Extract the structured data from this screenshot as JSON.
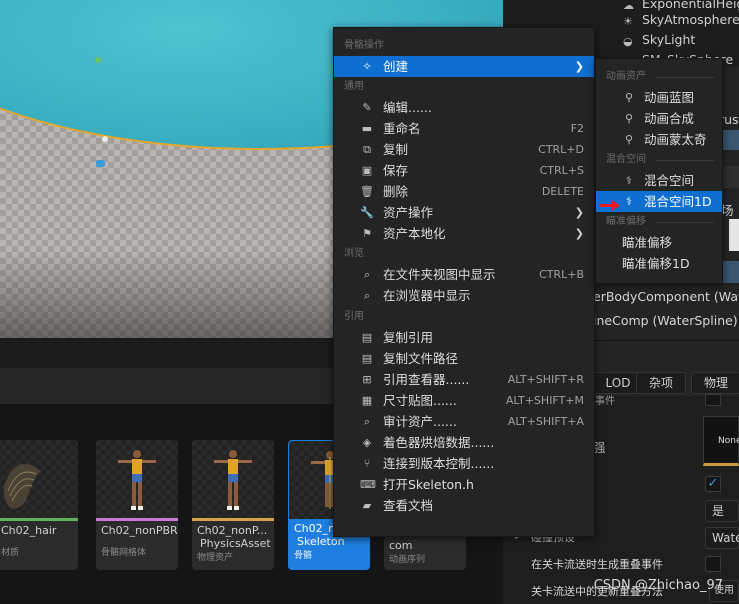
{
  "outliner": {
    "items": [
      {
        "label": "ExponentialHeightFo",
        "icon": "fog-icon"
      },
      {
        "label": "SkyAtmosphere",
        "icon": "sky-icon"
      },
      {
        "label": "SkyLight",
        "icon": "skylight-icon"
      },
      {
        "label": "SM_SkySphere",
        "icon": "sphere-icon"
      }
    ],
    "partial_rus": "rus",
    "partial_scene": "场",
    "water_body_component": "erBodyComponent (WaterB",
    "spline_comp": "ineComp (WaterSpline)"
  },
  "details": {
    "tabs": [
      "LOD",
      "杂项",
      "物理"
    ],
    "none_label": "None",
    "value_yes": "是",
    "value_water": "Water",
    "label_preview": "碰撞预设",
    "label_gen_overlap": "在关卡流送时生成重叠事件",
    "label_overlap_update": "关卡流送中的更新重叠方法",
    "value_use": "使用",
    "label_partial_1": "事件",
    "label_partial_2": "强"
  },
  "context_menu": {
    "sections": {
      "skeleton_ops": "骨骼操作",
      "common": "通用",
      "browse": "浏览",
      "reference": "引用"
    },
    "create": {
      "label": "创建",
      "icon": "create-icon"
    },
    "common_items": [
      {
        "label": "编辑......",
        "icon": "edit-icon",
        "shortcut": "",
        "submenu": false
      },
      {
        "label": "重命名",
        "icon": "rename-icon",
        "shortcut": "F2",
        "submenu": false
      },
      {
        "label": "复制",
        "icon": "copy-icon",
        "shortcut": "CTRL+D",
        "submenu": false
      },
      {
        "label": "保存",
        "icon": "save-icon",
        "shortcut": "CTRL+S",
        "submenu": false
      },
      {
        "label": "删除",
        "icon": "delete-icon",
        "shortcut": "DELETE",
        "submenu": false
      },
      {
        "label": "资产操作",
        "icon": "wrench-icon",
        "shortcut": "",
        "submenu": true
      },
      {
        "label": "资产本地化",
        "icon": "flag-icon",
        "shortcut": "",
        "submenu": true
      }
    ],
    "browse_items": [
      {
        "label": "在文件夹视图中显示",
        "icon": "folder-search-icon",
        "shortcut": "CTRL+B"
      },
      {
        "label": "在浏览器中显示",
        "icon": "browser-search-icon",
        "shortcut": ""
      }
    ],
    "reference_items": [
      {
        "label": "复制引用",
        "icon": "copy-reference-icon",
        "shortcut": ""
      },
      {
        "label": "复制文件路径",
        "icon": "copy-path-icon",
        "shortcut": ""
      },
      {
        "label": "引用查看器......",
        "icon": "reference-viewer-icon",
        "shortcut": "ALT+SHIFT+R"
      },
      {
        "label": "尺寸贴图......",
        "icon": "size-map-icon",
        "shortcut": "ALT+SHIFT+M"
      },
      {
        "label": "审计资产......",
        "icon": "audit-icon",
        "shortcut": "ALT+SHIFT+A"
      },
      {
        "label": "着色器烘焙数据......",
        "icon": "shader-icon",
        "shortcut": ""
      },
      {
        "label": "连接到版本控制......",
        "icon": "source-control-icon",
        "shortcut": ""
      },
      {
        "label": "打开Skeleton.h",
        "icon": "code-icon",
        "shortcut": ""
      },
      {
        "label": "查看文档",
        "icon": "docs-icon",
        "shortcut": ""
      }
    ]
  },
  "submenu": {
    "sections": {
      "anim_assets": "动画资产",
      "blend_space": "混合空间",
      "aim_offset": "瞄准偏移"
    },
    "anim_items": [
      {
        "label": "动画蓝图",
        "icon": "anim-blueprint-icon"
      },
      {
        "label": "动画合成",
        "icon": "anim-montage-composite-icon"
      },
      {
        "label": "动画蒙太奇",
        "icon": "anim-montage-icon"
      }
    ],
    "blend_items": [
      {
        "label": "混合空间",
        "icon": "blend-space-icon"
      },
      {
        "label": "混合空间1D",
        "icon": "blend-space-1d-icon"
      }
    ],
    "aim_items": [
      {
        "label": "瞄准偏移"
      },
      {
        "label": "瞄准偏移1D"
      }
    ]
  },
  "assets": [
    {
      "name": "Ch02_hair",
      "type": "材质",
      "color": "#5fb35f"
    },
    {
      "name": "Ch02_nonPBR",
      "type": "骨骼网格体",
      "color": "#c77bd6"
    },
    {
      "name": "Ch02_nonP...",
      "name2": "PhysicsAsset",
      "type": "物理资产",
      "color": "#d6a24a"
    },
    {
      "name": "Ch02_n",
      "name2": "Skeleton",
      "type": "骨骼",
      "color": "#1f7fe0"
    },
    {
      "name": "com",
      "type": "动画序列",
      "color": "#3cb0d6"
    }
  ],
  "watermark": "CSDN @Zhichao_97",
  "colors": {
    "selection": "#0f6fd1",
    "menu_bg": "#242424",
    "water": "#3bb0c3",
    "outline": "#e3a72c"
  }
}
